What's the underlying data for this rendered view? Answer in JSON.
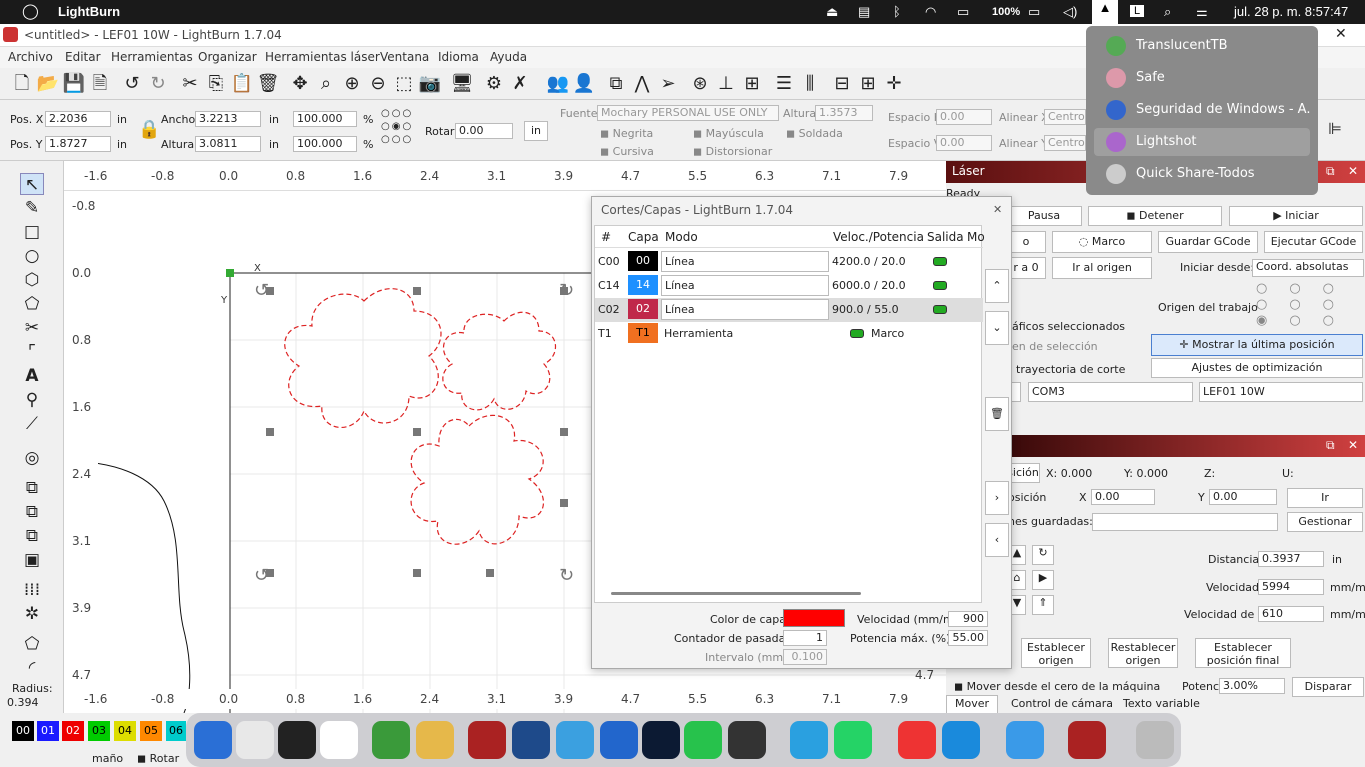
{
  "mac": {
    "app": "LightBurn",
    "battery": "100%",
    "lang": "L",
    "datetime": "jul. 28 p. m. 8:57:47"
  },
  "window": {
    "title": "<untitled> - LEF01 10W - LightBurn 1.7.04"
  },
  "menu": [
    "Archivo",
    "Editar",
    "Herramientas",
    "Organizar",
    "Herramientas láser",
    "Ventana",
    "Idioma",
    "Ayuda"
  ],
  "props": {
    "posx_label": "Pos. X",
    "posx": "2.2036",
    "posy_label": "Pos. Y",
    "posy": "1.8727",
    "unit": "in",
    "width_label": "Ancho",
    "width": "3.2213",
    "height_label": "Altura",
    "height": "3.0811",
    "scale_w": "100.000",
    "scale_h": "100.000",
    "pct": "%",
    "rot_label": "Rotar",
    "rot": "0.00",
    "in_btn": "in",
    "font_label": "Fuente",
    "font": "Mochary PERSONAL USE ONLY",
    "alt_label": "Altura",
    "alt": "1.3573",
    "bold": "Negrita",
    "italic": "Cursiva",
    "caps": "Mayúscula",
    "distort": "Distorsionar",
    "weld": "Soldada",
    "hspace_label": "Espacio H",
    "hspace": "0.00",
    "vspace_label": "Espacio V",
    "vspace": "0.00",
    "alignx_label": "Alinear X",
    "alignx": "Centro",
    "aligny_label": "Alinear Y",
    "aligny": "Centro"
  },
  "ruler": {
    "top": [
      "-1.6",
      "-0.8",
      "0.0",
      "0.8",
      "1.6",
      "2.4",
      "3.1",
      "3.9",
      "4.7",
      "5.5",
      "6.3",
      "7.1",
      "7.9"
    ],
    "left": [
      "-0.8",
      "0.0",
      "0.8",
      "1.6",
      "2.4",
      "3.1",
      "3.9",
      "4.7"
    ],
    "right_tail": "4.7"
  },
  "leftpanel": {
    "radius_label": "Radius:",
    "radius": "0.394"
  },
  "dialog": {
    "title": "Cortes/Capas - LightBurn 1.7.04",
    "headers": [
      "#",
      "Capa",
      "Modo",
      "Veloc./Potencia",
      "Salida",
      "Mo"
    ],
    "rows": [
      {
        "id": "C00",
        "layer": "00",
        "color": "#000000",
        "mode": "Línea",
        "speed": "4200.0 / 20.0"
      },
      {
        "id": "C14",
        "layer": "14",
        "color": "#1e90ff",
        "mode": "Línea",
        "speed": "6000.0 / 20.0"
      },
      {
        "id": "C02",
        "layer": "02",
        "color": "#c0284a",
        "mode": "Línea",
        "speed": "900.0 / 55.0"
      },
      {
        "id": "T1",
        "layer": "T1",
        "color": "#f07020",
        "mode": "Herramienta",
        "speed": "Marco"
      }
    ],
    "color_label": "Color de capa",
    "speed_label": "Velocidad (mm/m)",
    "speed": "900",
    "passes_label": "Contador de pasadas",
    "passes": "1",
    "power_label": "Potencia máx. (%)",
    "power": "55.00",
    "interval_label": "Intervalo (mm)",
    "interval": "0.100"
  },
  "laser": {
    "title": "Láser",
    "status": "Ready",
    "pause": "Pausa",
    "stop": "Detener",
    "start": "Iniciar",
    "frame": "Marco",
    "save_gcode": "Guardar GCode",
    "run_gcode": "Ejecutar GCode",
    "goto0": "r a 0",
    "origin": "Ir al origen",
    "start_from_label": "Iniciar desde:",
    "start_from": "Coord. absolutas",
    "job_origin": "Origen del trabajo",
    "sel_graphics": "áficos seleccionados",
    "sel_origin": "en de selección",
    "show_last": "Mostrar la última posición",
    "cut_path": "trayectoria de corte",
    "optim": "Ajustes de optimización",
    "port": "COM3",
    "device": "LEF01 10W"
  },
  "move": {
    "pos_btn": "sición",
    "x0": "X: 0.000",
    "y0": "Y: 0.000",
    "z": "Z:",
    "u": "U:",
    "pos2": "osición",
    "xl": "X",
    "x": "0.00",
    "yl": "Y",
    "y": "0.00",
    "go": "Ir",
    "saved": "nes guardadas:",
    "manage": "Gestionar",
    "dist_label": "Distancia",
    "dist": "0.3937",
    "dist_unit": "in",
    "vel_label": "Velocidad",
    "vel": "5994",
    "vel_unit": "mm/m",
    "velz_label": "Velocidad de Z",
    "velz": "610",
    "velz_unit": "mm/m",
    "set_origin": "Establecer origen",
    "reset_origin": "Restablecer origen",
    "set_final": "Establecer posición final",
    "move_from_zero": "Mover desde el cero de la máquina",
    "power_label": "Potencia",
    "power": "3.00%",
    "fire": "Disparar"
  },
  "tabs": [
    "Mover",
    "Control de cámara",
    "Texto variable"
  ],
  "popup": [
    "TranslucentTB",
    "Safe",
    "Seguridad de Windows - A...",
    "Lightshot",
    "Quick Share-Todos"
  ],
  "palette": [
    "00",
    "01",
    "02",
    "03",
    "04",
    "05",
    "06"
  ],
  "bottom": {
    "size": "maño",
    "rotate": "Rotar"
  },
  "close": "✕"
}
